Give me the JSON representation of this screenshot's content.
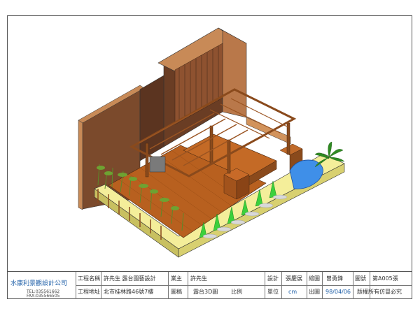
{
  "drawing": {
    "subject": "Isometric rooftop garden render",
    "colors": {
      "wall_brown": "#7b4a2c",
      "wall_brown_dark": "#5b3420",
      "wall_tan": "#c88a57",
      "deck": "#b8601f",
      "pergola": "#8a4a1c",
      "planter_yellow": "#f4ee9a",
      "planter_side": "#c8c060",
      "pool_blue": "#3f8fe8",
      "plant_green": "#3cd03c",
      "bamboo_green": "#5a8a2a"
    }
  },
  "titleblock": {
    "company": "水康利景觀設計公司",
    "tel": "TEL:035561662",
    "fax": "FAX:035566505",
    "project_name_label": "工程名稱",
    "project_name": "許先生 露台園藝設計",
    "project_address_label": "工程地址",
    "project_address": "北市桂林路46號7樓",
    "owner_label": "業主",
    "owner": "許先生",
    "drawing_label": "圖稿",
    "drawing_value": "露台3D圖",
    "scale_label": "比例",
    "scale_value": "",
    "design_label": "設計",
    "design_value": "張慶展",
    "unit_label": "單位",
    "unit_value": "cm",
    "draw_label": "繪圖",
    "draw_value": "曾勇鋒",
    "date_label": "出圖",
    "date_value": "98/04/06",
    "sheet_label": "圖號",
    "sheet_value": "第A005張",
    "copyright": "版權所有仿冒必究"
  }
}
